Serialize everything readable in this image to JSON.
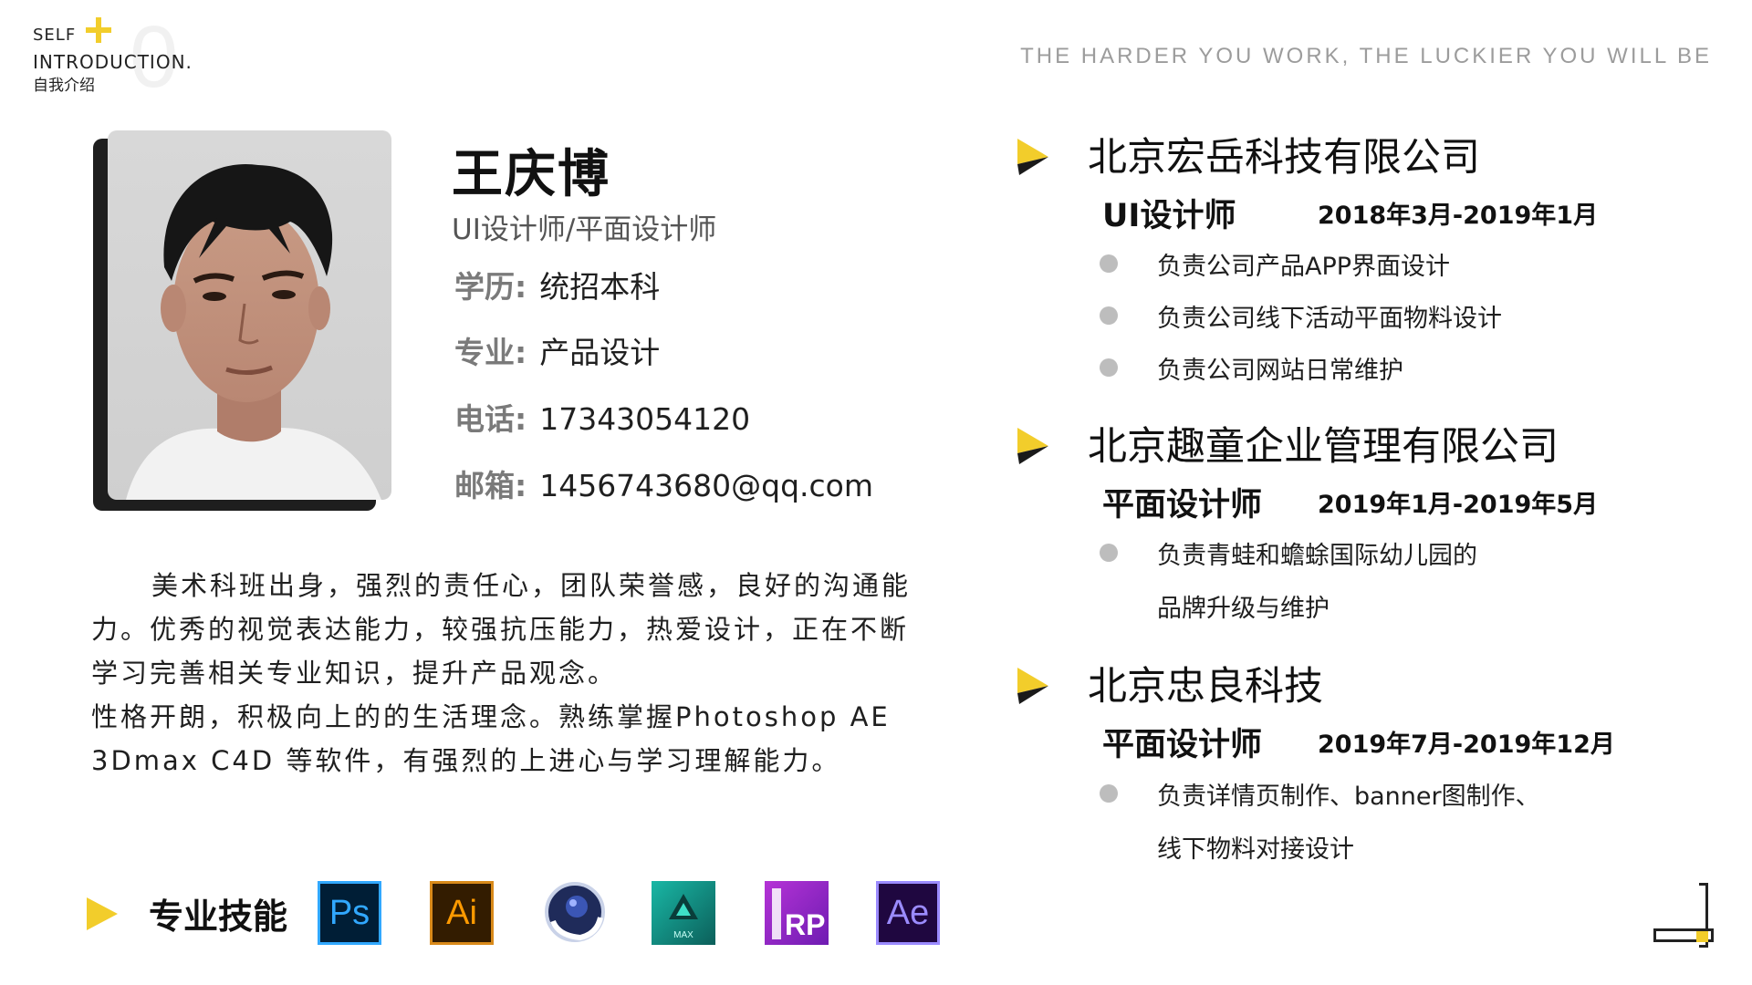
{
  "header": {
    "self": "SELF",
    "introduction": "INTRODUCTION.",
    "subtitle_cn": "自我介绍",
    "number": "0",
    "slogan": "THE HARDER YOU WORK, THE LUCKIER YOU WILL BE"
  },
  "colors": {
    "accent": "#f2cd2b",
    "dark": "#1e1e1e",
    "muted": "#9c9c9c"
  },
  "profile": {
    "name": "王庆博",
    "title": "UI设计师/平面设计师",
    "info": [
      {
        "label": "学历:",
        "value": "统招本科"
      },
      {
        "label": "专业:",
        "value": "产品设计"
      },
      {
        "label": "电话:",
        "value": "17343054120"
      },
      {
        "label": "邮箱:",
        "value": "1456743680@qq.com"
      }
    ]
  },
  "bio": {
    "p1": "美术科班出身，强烈的责任心，团队荣誉感，良好的沟通能力。优秀的视觉表达能力，较强抗压能力，热爱设计，正在不断学习完善相关专业知识，提升产品观念。",
    "p2": "性格开朗，积极向上的的生活理念。熟练掌握Photoshop AE 3Dmax C4D 等软件，有强烈的上进心与学习理解能力。"
  },
  "skills": {
    "title": "专业技能",
    "items": [
      {
        "name": "photoshop-icon",
        "label": "Ps"
      },
      {
        "name": "illustrator-icon",
        "label": "Ai"
      },
      {
        "name": "cinema4d-icon",
        "label": ""
      },
      {
        "name": "3dsmax-icon",
        "label": "MAX"
      },
      {
        "name": "axure-rp-icon",
        "label": "RP"
      },
      {
        "name": "after-effects-icon",
        "label": "Ae"
      }
    ]
  },
  "experience": [
    {
      "company": "北京宏岳科技有限公司",
      "role": "UI设计师",
      "period": "2018年3月-2019年1月",
      "duties": [
        "负责公司产品APP界面设计",
        "负责公司线下活动平面物料设计",
        "负责公司网站日常维护"
      ]
    },
    {
      "company": "北京趣童企业管理有限公司",
      "role": "平面设计师",
      "period": "2019年1月-2019年5月",
      "duties": [
        "负责青蛙和蟾蜍国际幼儿园的",
        "品牌升级与维护"
      ]
    },
    {
      "company": "北京忠良科技",
      "role": "平面设计师",
      "period": "2019年7月-2019年12月",
      "duties": [
        "负责详情页制作、banner图制作、",
        "线下物料对接设计"
      ]
    }
  ]
}
